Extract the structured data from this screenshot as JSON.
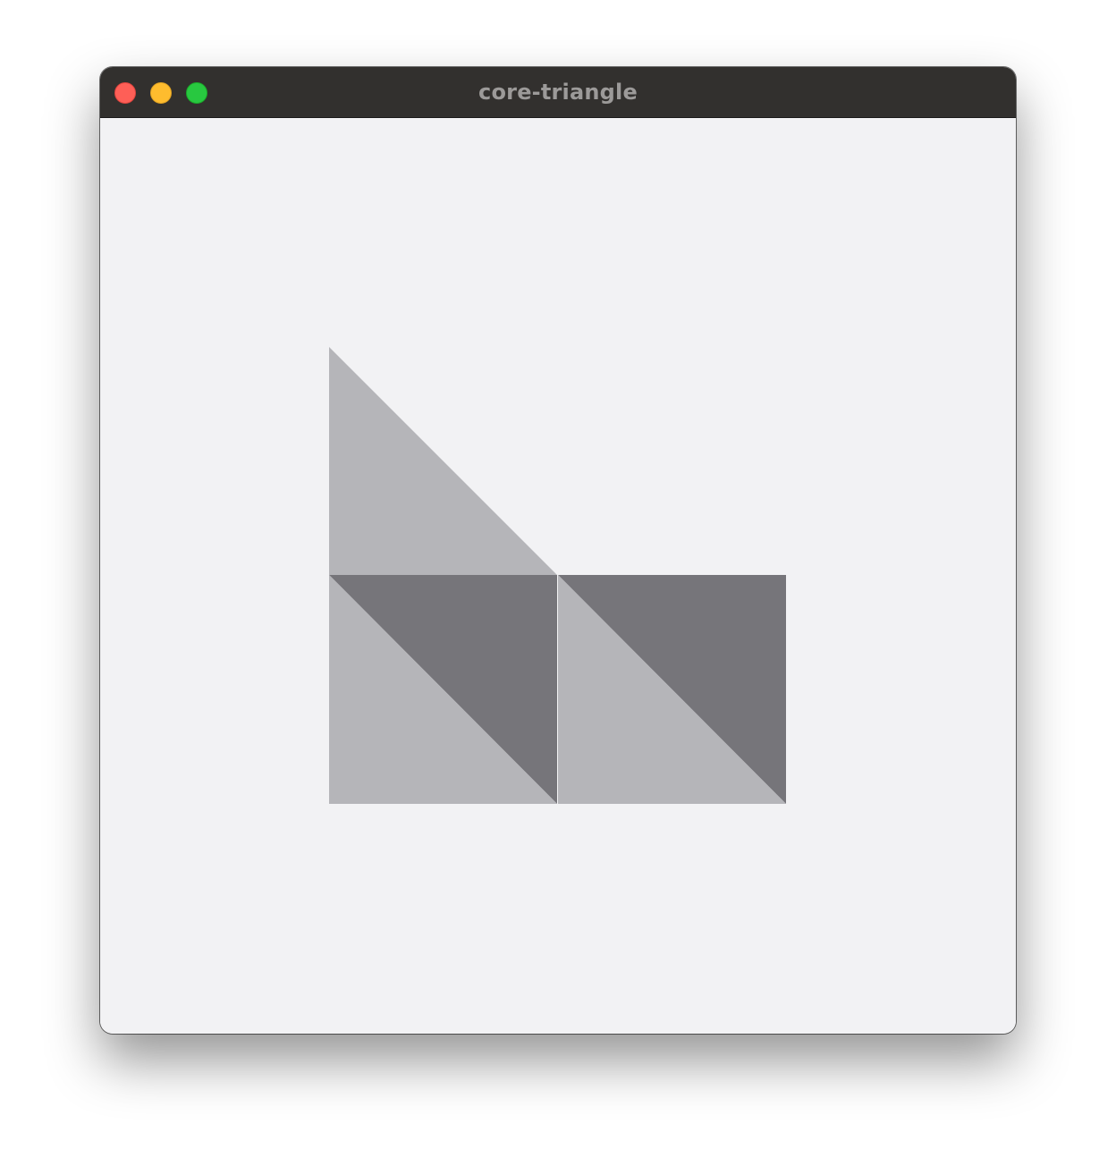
{
  "window": {
    "title": "core-triangle"
  },
  "colors": {
    "canvas_background": "#f2f2f4",
    "titlebar": "#32302e",
    "title_text": "#9c9a99",
    "light_triangle": "#b5b5b9",
    "dark_triangle": "#76757a",
    "close_button": "#fe5f57",
    "minimize_button": "#febc2e",
    "zoom_button": "#28c840"
  },
  "icons": [
    "close-icon",
    "minimize-icon",
    "zoom-icon"
  ]
}
